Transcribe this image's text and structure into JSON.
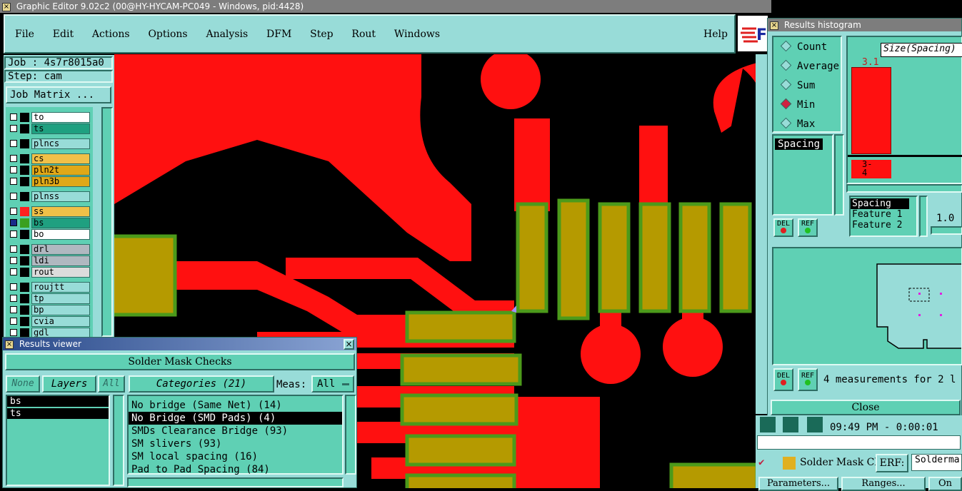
{
  "window": {
    "title": "Graphic Editor 9.02c2 (00@HY-HYCAM-PC049 - Windows, pid:4428)"
  },
  "menu": {
    "items": [
      "File",
      "Edit",
      "Actions",
      "Options",
      "Analysis",
      "DFM",
      "Step",
      "Rout",
      "Windows"
    ],
    "help": "Help"
  },
  "job": {
    "job_label": "Job : 4s7r8015a0",
    "step_label": "Step: cam",
    "matrix_button": "Job Matrix ..."
  },
  "layers": [
    {
      "name": "to",
      "color": "#ffffff"
    },
    {
      "name": "ts",
      "color": "#1fa080"
    },
    {
      "name": "plncs",
      "color": "#98dcd8"
    },
    {
      "name": "cs",
      "color": "#f0c048"
    },
    {
      "name": "pln2t",
      "color": "#e0a818"
    },
    {
      "name": "pln3b",
      "color": "#e0a818"
    },
    {
      "name": "plnss",
      "color": "#98dcd8"
    },
    {
      "name": "ss",
      "color": "#f0c048"
    },
    {
      "name": "bs",
      "color": "#1fa080"
    },
    {
      "name": "bo",
      "color": "#ffffff"
    },
    {
      "name": "drl",
      "color": "#b0b8c0"
    },
    {
      "name": "ldi",
      "color": "#b0b8c0"
    },
    {
      "name": "rout",
      "color": "#dcdcdc"
    },
    {
      "name": "roujtt",
      "color": "#98dcd8"
    },
    {
      "name": "tp",
      "color": "#98dcd8"
    },
    {
      "name": "bp",
      "color": "#98dcd8"
    },
    {
      "name": "cvia",
      "color": "#98dcd8"
    },
    {
      "name": "gdl",
      "color": "#98dcd8"
    }
  ],
  "results_viewer": {
    "title": "Results viewer",
    "header": "Solder Mask Checks",
    "none_btn": "None",
    "layers_btn": "Layers",
    "all_btn": "All",
    "categories_btn": "Categories (21)",
    "meas_label": "Meas:",
    "meas_value": "All",
    "layer_list": [
      "bs",
      "ts"
    ],
    "categories": [
      "No bridge (Same Net) (14)",
      "No Bridge (SMD Pads) (4)",
      "SMDs Clearance Bridge (93)",
      "SM slivers (93)",
      "SM local spacing (16)",
      "Pad to Pad Spacing (84)"
    ],
    "selected_index": 1
  },
  "histogram": {
    "title": "Results histogram",
    "radios": [
      "Count",
      "Average",
      "Sum",
      "Min",
      "Max"
    ],
    "selected_radio": "Min",
    "list_item": "Spacing",
    "size_label": "Size(Spacing)",
    "bar_value": "3.1",
    "bar2_label": "3-\n4",
    "del": "DEL",
    "ref": "REF",
    "attr_list": [
      "Spacing",
      "Feature 1",
      "Feature 2"
    ],
    "scale_value": "1.0",
    "measurements": "4 measurements for 2 l",
    "close": "Close"
  },
  "status": {
    "time": "09:49 PM - 0:00:01"
  },
  "bottom": {
    "checklist": "Solder Mask Ch",
    "erf": "ERF:",
    "erf_value": "Solderma",
    "parameters": "Parameters...",
    "ranges": "Ranges...",
    "on": "On"
  }
}
